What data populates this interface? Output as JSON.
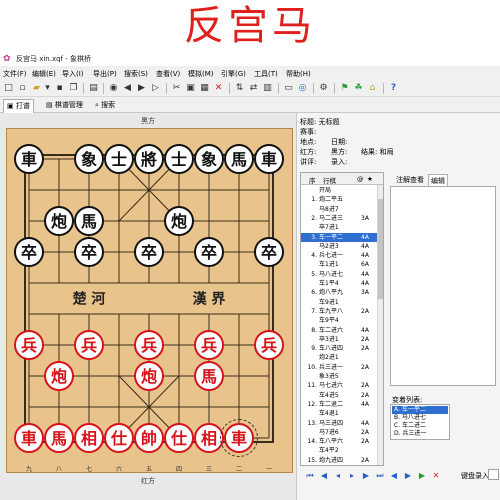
{
  "banner": {
    "title": "反宫马"
  },
  "window": {
    "title": "反宫马   xin.xqf - 象棋桥"
  },
  "menu": [
    "文件(F)",
    "编辑(E)",
    "导入(I)",
    "导出(P)",
    "搜索(S)",
    "查看(V)",
    "模拟(M)",
    "引擎(G)",
    "工具(T)",
    "帮助(H)"
  ],
  "tabs": [
    "打谱",
    "棋谱管理",
    "搜索"
  ],
  "board": {
    "top_side": "黑方",
    "bottom_side": "红方",
    "river_left": "楚  河",
    "river_right": "漢  界",
    "bottom_files": [
      "九",
      "八",
      "七",
      "六",
      "五",
      "四",
      "三",
      "二",
      "一"
    ],
    "black_pieces": [
      {
        "char": "車",
        "file": 0,
        "rank": 0
      },
      {
        "char": "象",
        "file": 2,
        "rank": 0
      },
      {
        "char": "士",
        "file": 3,
        "rank": 0
      },
      {
        "char": "將",
        "file": 4,
        "rank": 0
      },
      {
        "char": "士",
        "file": 5,
        "rank": 0
      },
      {
        "char": "象",
        "file": 6,
        "rank": 0
      },
      {
        "char": "馬",
        "file": 7,
        "rank": 0
      },
      {
        "char": "車",
        "file": 8,
        "rank": 0
      },
      {
        "char": "炮",
        "file": 1,
        "rank": 2
      },
      {
        "char": "馬",
        "file": 2,
        "rank": 2
      },
      {
        "char": "炮",
        "file": 5,
        "rank": 2
      },
      {
        "char": "卒",
        "file": 0,
        "rank": 3
      },
      {
        "char": "卒",
        "file": 2,
        "rank": 3
      },
      {
        "char": "卒",
        "file": 4,
        "rank": 3
      },
      {
        "char": "卒",
        "file": 6,
        "rank": 3
      },
      {
        "char": "卒",
        "file": 8,
        "rank": 3
      }
    ],
    "red_pieces": [
      {
        "char": "兵",
        "file": 0,
        "rank": 6
      },
      {
        "char": "兵",
        "file": 2,
        "rank": 6
      },
      {
        "char": "兵",
        "file": 4,
        "rank": 6
      },
      {
        "char": "兵",
        "file": 6,
        "rank": 6
      },
      {
        "char": "兵",
        "file": 8,
        "rank": 6
      },
      {
        "char": "炮",
        "file": 1,
        "rank": 7
      },
      {
        "char": "炮",
        "file": 4,
        "rank": 7
      },
      {
        "char": "馬",
        "file": 6,
        "rank": 7
      },
      {
        "char": "車",
        "file": 0,
        "rank": 9
      },
      {
        "char": "馬",
        "file": 1,
        "rank": 9
      },
      {
        "char": "相",
        "file": 2,
        "rank": 9
      },
      {
        "char": "仕",
        "file": 3,
        "rank": 9
      },
      {
        "char": "帥",
        "file": 4,
        "rank": 9
      },
      {
        "char": "仕",
        "file": 5,
        "rank": 9
      },
      {
        "char": "相",
        "file": 6,
        "rank": 9
      },
      {
        "char": "車",
        "file": 7,
        "rank": 9,
        "selected": true
      }
    ]
  },
  "info": {
    "title_label": "标题:",
    "title_value": "无标题",
    "event_label": "赛事:",
    "place_label": "地点:",
    "date_label": "日期:",
    "red_label": "红方:",
    "black_label": "黑方:",
    "result_label": "结果:",
    "result_value": "和局",
    "commentator_label": "讲评:",
    "recorder_label": "录入:"
  },
  "moves": {
    "col_num": "序",
    "col_move": "行棋",
    "col_a": "@",
    "col_b": "★",
    "rows": [
      {
        "num": "",
        "text": "开局",
        "tag": ""
      },
      {
        "num": "1.",
        "text": "炮二平五",
        "tag": ""
      },
      {
        "num": "",
        "text": "马8进7",
        "tag": ""
      },
      {
        "num": "2.",
        "text": "马二进三",
        "tag": "3A"
      },
      {
        "num": "",
        "text": "卒7进1",
        "tag": ""
      },
      {
        "num": "3.",
        "text": "车一平二",
        "tag": "4A",
        "selected": true
      },
      {
        "num": "",
        "text": "马2进3",
        "tag": "4A"
      },
      {
        "num": "4.",
        "text": "兵七进一",
        "tag": "4A"
      },
      {
        "num": "",
        "text": "车1进1",
        "tag": "6A"
      },
      {
        "num": "5.",
        "text": "马八进七",
        "tag": "4A"
      },
      {
        "num": "",
        "text": "车1平4",
        "tag": "4A"
      },
      {
        "num": "6.",
        "text": "炮八平九",
        "tag": "3A"
      },
      {
        "num": "",
        "text": "车9进1",
        "tag": ""
      },
      {
        "num": "7.",
        "text": "车九平八",
        "tag": "2A"
      },
      {
        "num": "",
        "text": "车9平4",
        "tag": ""
      },
      {
        "num": "8.",
        "text": "车二进六",
        "tag": "4A"
      },
      {
        "num": "",
        "text": "卒3进1",
        "tag": "2A"
      },
      {
        "num": "9.",
        "text": "车八进四",
        "tag": "2A"
      },
      {
        "num": "",
        "text": "炮2进1",
        "tag": ""
      },
      {
        "num": "10.",
        "text": "兵三进一",
        "tag": "2A"
      },
      {
        "num": "",
        "text": "象3进5",
        "tag": ""
      },
      {
        "num": "11.",
        "text": "马七进六",
        "tag": "2A"
      },
      {
        "num": "",
        "text": "车4进5",
        "tag": "2A"
      },
      {
        "num": "12.",
        "text": "车二退二",
        "tag": "4A"
      },
      {
        "num": "",
        "text": "车4退1",
        "tag": ""
      },
      {
        "num": "13.",
        "text": "马三进四",
        "tag": "4A"
      },
      {
        "num": "",
        "text": "马7进6",
        "tag": "2A"
      },
      {
        "num": "14.",
        "text": "车八平六",
        "tag": "2A"
      },
      {
        "num": "",
        "text": "车4平2",
        "tag": ""
      },
      {
        "num": "15.",
        "text": "炮九进四",
        "tag": "2A"
      }
    ]
  },
  "comment_tabs": [
    "注解查看",
    "编辑"
  ],
  "variations": {
    "label": "变着列表:",
    "rows": [
      {
        "text": "A. 车一平二",
        "selected": true
      },
      {
        "text": "B. 马八进七"
      },
      {
        "text": "C. 车二进二"
      },
      {
        "text": "D. 兵三进一"
      }
    ]
  },
  "nav": {
    "entry_label": "键盘录入:"
  },
  "colors": {
    "banner_red": "#e0201c",
    "red_piece": "#d8121a",
    "board": "#e8c48c",
    "selection": "#2f6fd0"
  }
}
